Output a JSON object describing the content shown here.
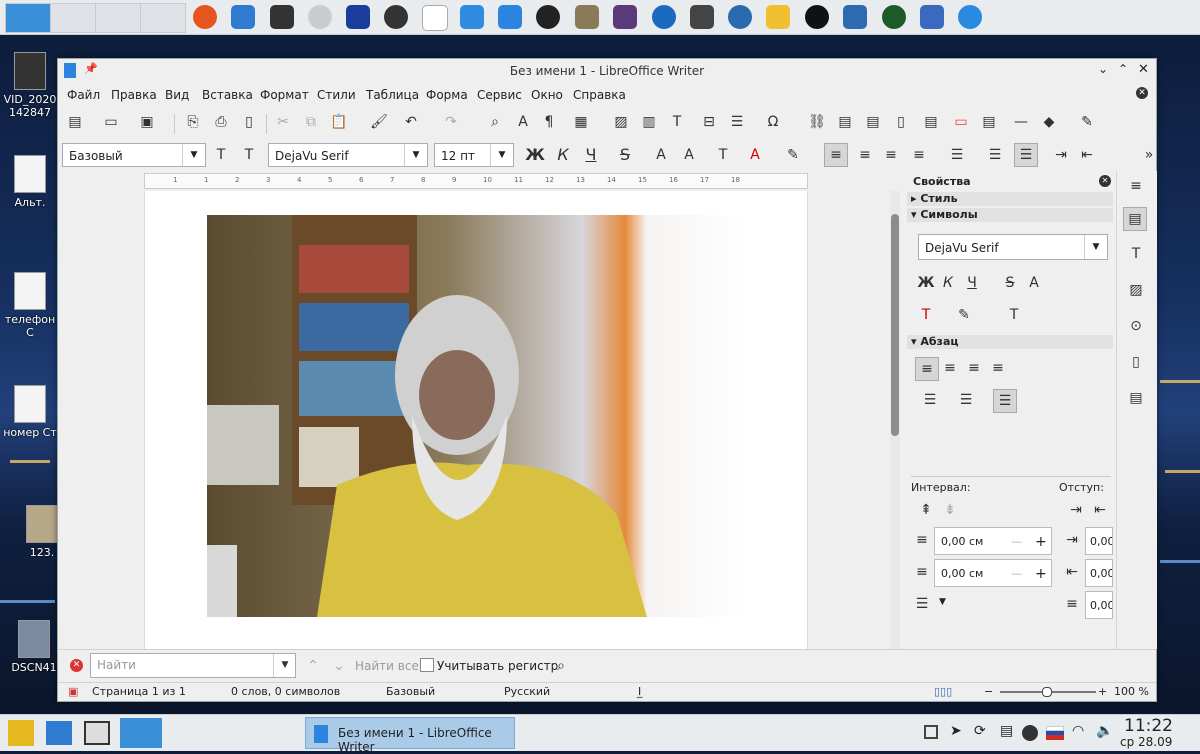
{
  "desktop": {
    "icons": [
      {
        "label": "VID_2020 142847"
      },
      {
        "label": "Альт."
      },
      {
        "label": "телефон С"
      },
      {
        "label": "номер Ст"
      },
      {
        "label": "123."
      },
      {
        "label": "DSCN41"
      }
    ]
  },
  "window": {
    "title": "Без имени 1 - LibreOffice Writer",
    "menu": [
      "Файл",
      "Правка",
      "Вид",
      "Вставка",
      "Формат",
      "Стили",
      "Таблица",
      "Форма",
      "Сервис",
      "Окно",
      "Справка"
    ]
  },
  "formatting": {
    "paragraph_style": "Базовый",
    "font_name": "DejaVu Serif",
    "font_size": "12 пт",
    "bold_label": "Ж",
    "italic_label": "К",
    "underline_label": "Ч"
  },
  "ruler": {
    "ticks": [
      "1",
      "1",
      "2",
      "3",
      "4",
      "5",
      "6",
      "7",
      "8",
      "9",
      "10",
      "11",
      "12",
      "13",
      "14",
      "15",
      "16",
      "17",
      "18"
    ]
  },
  "sidebar": {
    "title": "Свойства",
    "sections": {
      "style": "Стиль",
      "characters": "Символы",
      "paragraph": "Абзац"
    },
    "font_name": "DejaVu Serif",
    "bold_label": "Ж",
    "italic_label": "К",
    "underline_label": "Ч",
    "interval_label": "Интервал:",
    "indent_label": "Отступ:",
    "spacing_above": "0,00 см",
    "spacing_below": "0,00 см",
    "indent_values": [
      "0,00",
      "0,00",
      "0,00"
    ]
  },
  "findbar": {
    "placeholder": "Найти",
    "find_all": "Найти все",
    "match_case": "Учитывать регистр"
  },
  "status": {
    "page": "Страница 1 из 1",
    "words": "0 слов, 0 символов",
    "style": "Базовый",
    "language": "Русский",
    "zoom": "100 %"
  },
  "taskbar": {
    "task_title": "Без имени 1 - LibreOffice Writer",
    "time": "11:22",
    "date": "ср 28.09"
  }
}
